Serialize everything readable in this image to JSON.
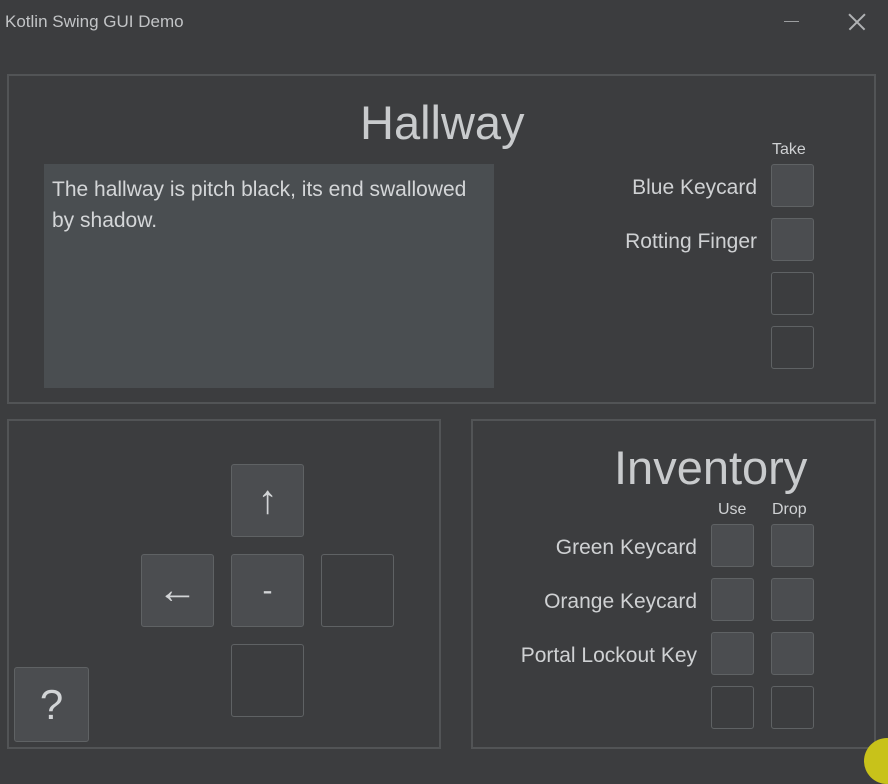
{
  "window": {
    "title": "Kotlin Swing GUI Demo"
  },
  "room": {
    "title": "Hallway",
    "description": "The hallway is pitch black, its end swallowed by shadow.",
    "take_header": "Take",
    "items": [
      "Blue Keycard",
      "Rotting Finger"
    ]
  },
  "navigation": {
    "north": "↑",
    "west": "←",
    "center": "-",
    "help": "?"
  },
  "inventory": {
    "title": "Inventory",
    "use_header": "Use",
    "drop_header": "Drop",
    "items": [
      "Green Keycard",
      "Orange Keycard",
      "Portal Lockout Key"
    ]
  },
  "colors": {
    "background": "#3c3d3f",
    "panel_border": "#525456",
    "text_area": "#4a4e51",
    "filled_slot": "#4b4d50",
    "cursor_highlight": "#c8c21a"
  }
}
